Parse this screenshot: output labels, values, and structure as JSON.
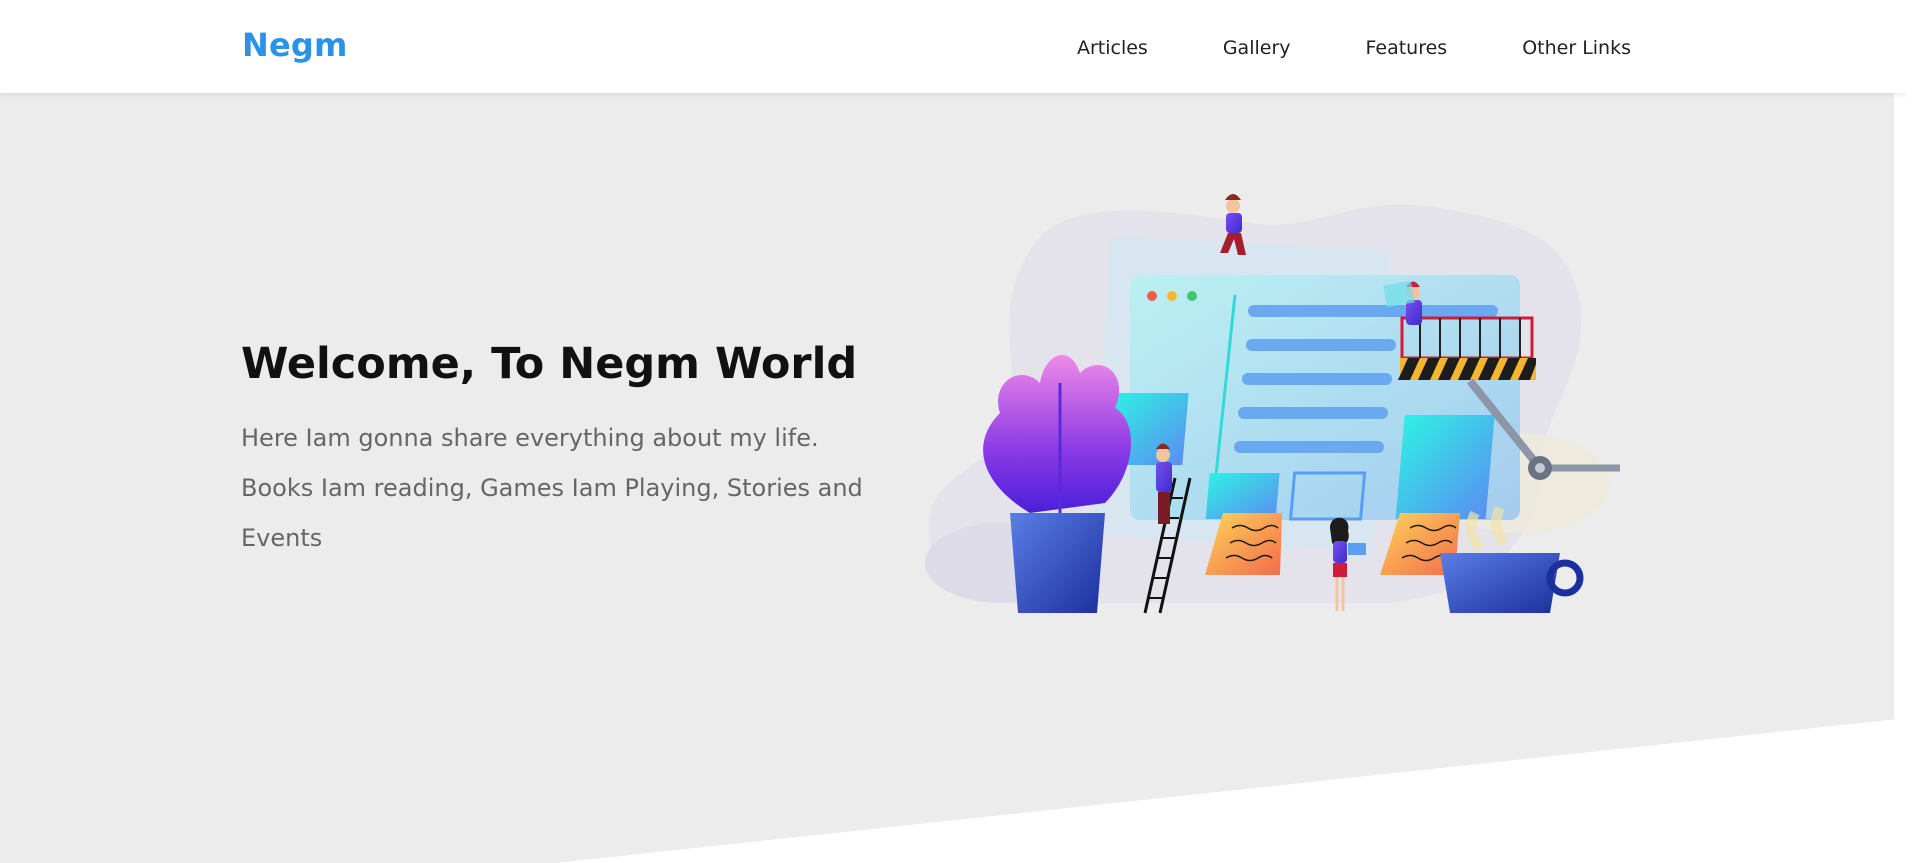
{
  "header": {
    "logo": "Negm",
    "nav": [
      "Articles",
      "Gallery",
      "Features",
      "Other Links"
    ]
  },
  "hero": {
    "title": "Welcome, To Negm World",
    "description": "Here Iam gonna share everything about my life. Books Iam reading, Games Iam Playing, Stories and Events"
  },
  "colors": {
    "accent": "#2a93e8",
    "hero_bg": "#ececec"
  }
}
